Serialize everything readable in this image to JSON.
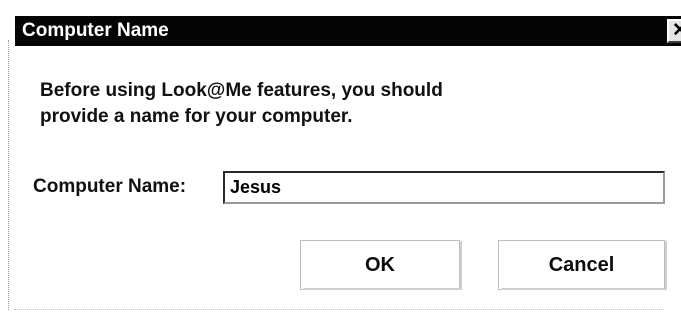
{
  "dialog": {
    "title": "Computer Name",
    "close_symbol": "✕",
    "close_icon": "close-icon",
    "message_lines": [
      "Before using Look@Me features, you should",
      "provide a name for your computer."
    ],
    "name_label": "Computer Name:",
    "name_value": "Jesus",
    "ok_label": "OK",
    "cancel_label": "Cancel"
  },
  "colors": {
    "title_bar": "#050505",
    "title_text": "#ffffff",
    "background": "#ffffff"
  }
}
